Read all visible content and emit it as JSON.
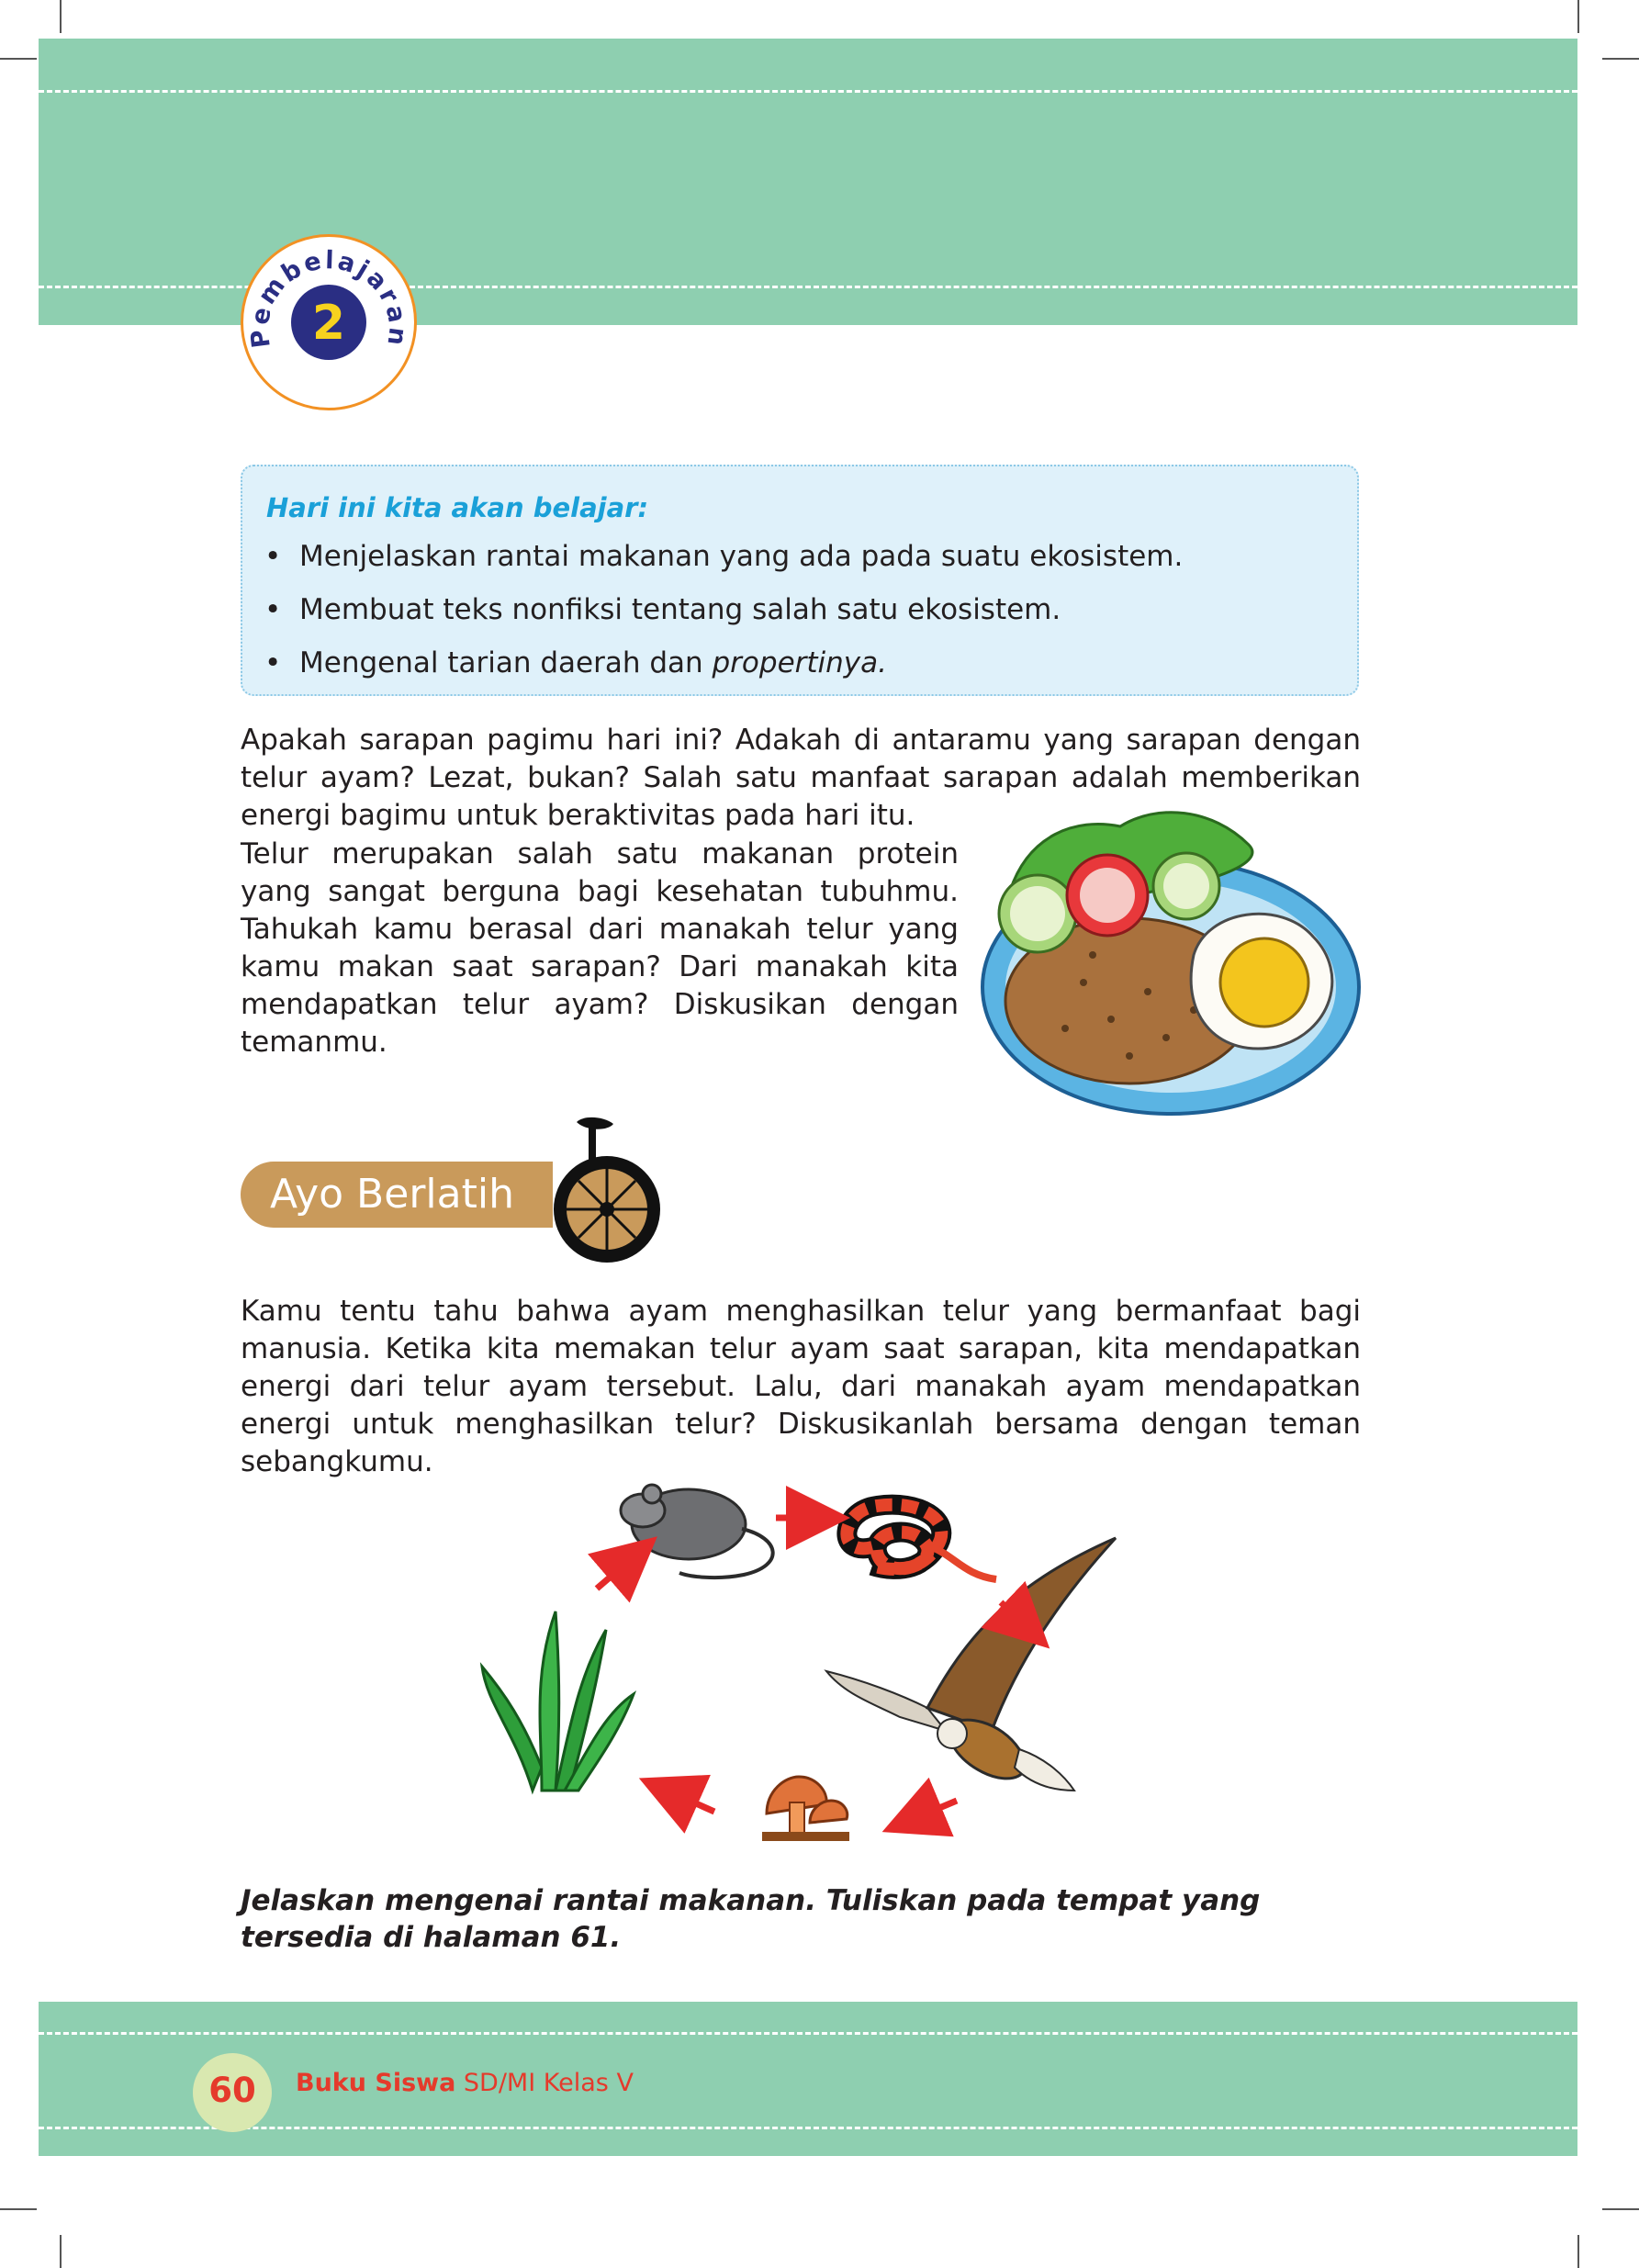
{
  "header": {
    "badge_word": "Pembelajaran",
    "badge_number": "2"
  },
  "goals": {
    "title": "Hari ini kita akan belajar:",
    "items": [
      "Menjelaskan rantai makanan yang ada pada suatu ekosistem.",
      "Membuat teks nonfiksi tentang salah satu ekosistem.",
      "Mengenal tarian daerah dan "
    ],
    "item3_italic": "propertinya."
  },
  "intro": {
    "line_top": "Apakah sarapan pagimu hari ini? Adakah di antaramu yang sarapan dengan telur ayam? Lezat, bukan? Salah satu manfaat sarapan adalah memberikan energi bagimu untuk beraktivitas pada hari itu.",
    "line_side": "Telur merupakan salah satu makanan protein yang sangat berguna bagi kesehatan tubuhmu. Tahukah kamu berasal dari manakah telur yang kamu makan saat sarapan? Dari manakah kita mendapatkan telur ayam? Diskusikan dengan temanmu."
  },
  "practice": {
    "label": "Ayo Berlatih",
    "text": "Kamu tentu tahu bahwa ayam menghasilkan telur yang bermanfaat bagi manusia.  Ketika kita memakan telur ayam saat sarapan, kita mendapatkan energi dari telur ayam tersebut. Lalu, dari manakah ayam mendapatkan energi untuk menghasilkan telur? Diskusikanlah bersama dengan teman sebangkumu."
  },
  "instruction": "Jelaskan mengenai rantai makanan. Tuliskan pada tempat yang tersedia di halaman 61.",
  "footer": {
    "page_number": "60",
    "book_bold": "Buku Siswa",
    "book_rest": " SD/MI Kelas V"
  },
  "colors": {
    "band": "#8ecfb0",
    "badge_ring": "#f29123",
    "badge_fill": "#2a2e83",
    "badge_number": "#f7d21e",
    "goals_title": "#1aa0d8",
    "practice_tab": "#c99a5b",
    "footer_text": "#e53a2b",
    "arrow": "#e52a2a"
  }
}
